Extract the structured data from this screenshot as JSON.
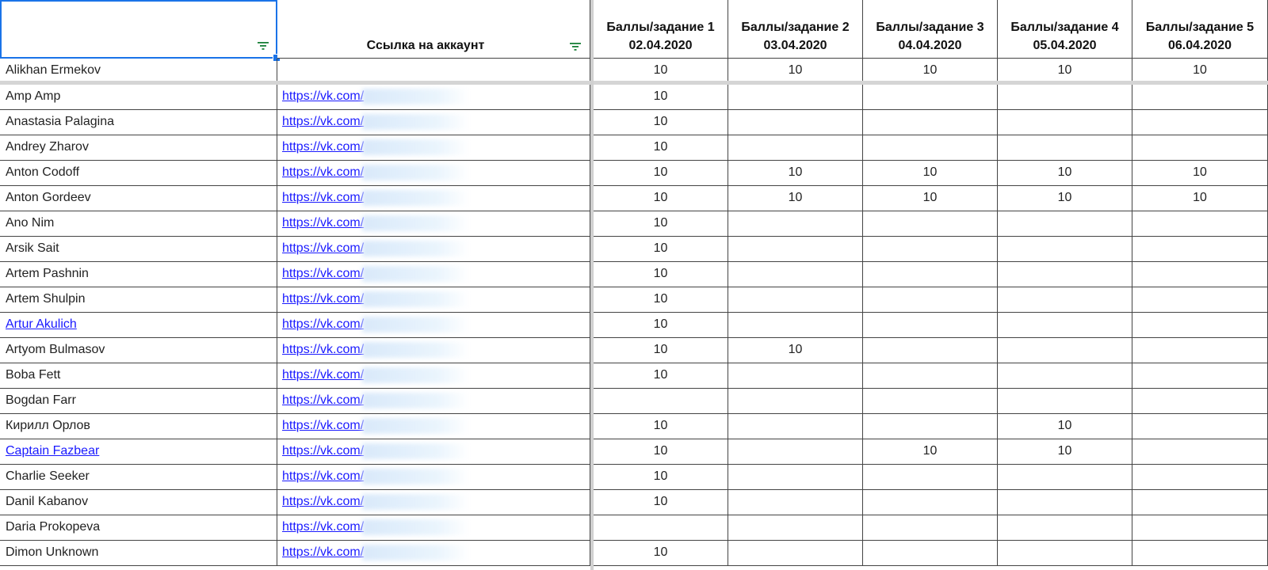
{
  "header": {
    "name_col": "",
    "link_col": "Ссылка на аккаунт",
    "tasks": [
      {
        "label": "Баллы/задание 1",
        "date": "02.04.2020"
      },
      {
        "label": "Баллы/задание 2",
        "date": "03.04.2020"
      },
      {
        "label": "Баллы/задание 3",
        "date": "04.04.2020"
      },
      {
        "label": "Баллы/задание 4",
        "date": "05.04.2020"
      },
      {
        "label": "Баллы/задание 5",
        "date": "06.04.2020"
      }
    ]
  },
  "icons": {
    "filter": "filter-icon"
  },
  "colors": {
    "selection": "#1a73e8",
    "link": "#1a1aff",
    "filter_icon": "#188038"
  },
  "pinned_row": {
    "name": "Alikhan Ermekov",
    "link": "",
    "scores": [
      "10",
      "10",
      "10",
      "10",
      "10"
    ]
  },
  "rows": [
    {
      "name": "Amp Amp",
      "link": "https://vk.com/",
      "scores": [
        "10",
        "",
        "",
        "",
        ""
      ]
    },
    {
      "name": "Anastasia Palagina",
      "link": "https://vk.com/",
      "scores": [
        "10",
        "",
        "",
        "",
        ""
      ]
    },
    {
      "name": "Andrey Zharov",
      "link": "https://vk.com/",
      "scores": [
        "10",
        "",
        "",
        "",
        ""
      ]
    },
    {
      "name": "Anton Codoff",
      "link": "https://vk.com/",
      "scores": [
        "10",
        "10",
        "10",
        "10",
        "10"
      ]
    },
    {
      "name": "Anton Gordeev",
      "link": "https://vk.com/",
      "scores": [
        "10",
        "10",
        "10",
        "10",
        "10"
      ]
    },
    {
      "name": "Ano Nim",
      "link": "https://vk.com/",
      "scores": [
        "10",
        "",
        "",
        "",
        ""
      ]
    },
    {
      "name": "Arsik Sait",
      "link": "https://vk.com/",
      "scores": [
        "10",
        "",
        "",
        "",
        ""
      ]
    },
    {
      "name": "Artem Pashnin",
      "link": "https://vk.com/",
      "scores": [
        "10",
        "",
        "",
        "",
        ""
      ]
    },
    {
      "name": "Artem Shulpin",
      "link": "https://vk.com/",
      "scores": [
        "10",
        "",
        "",
        "",
        ""
      ]
    },
    {
      "name": "Artur Akulich",
      "name_is_link": true,
      "link": "https://vk.com/",
      "scores": [
        "10",
        "",
        "",
        "",
        ""
      ]
    },
    {
      "name": "Artyom Bulmasov",
      "link": "https://vk.com/",
      "scores": [
        "10",
        "10",
        "",
        "",
        ""
      ]
    },
    {
      "name": "Boba Fett",
      "link": "https://vk.com/",
      "scores": [
        "10",
        "",
        "",
        "",
        ""
      ]
    },
    {
      "name": "Bogdan Farr",
      "link": "https://vk.com/",
      "scores": [
        "",
        "",
        "",
        "",
        ""
      ]
    },
    {
      "name": "Кирилл Орлов",
      "link": "https://vk.com/",
      "scores": [
        "10",
        "",
        "",
        "10",
        ""
      ]
    },
    {
      "name": "Captain Fazbear",
      "name_is_link": true,
      "link": "https://vk.com/",
      "scores": [
        "10",
        "",
        "10",
        "10",
        ""
      ]
    },
    {
      "name": "Charlie Seeker",
      "link": "https://vk.com/",
      "scores": [
        "10",
        "",
        "",
        "",
        ""
      ]
    },
    {
      "name": "Danil Kabanov",
      "link": "https://vk.com/",
      "scores": [
        "10",
        "",
        "",
        "",
        ""
      ]
    },
    {
      "name": "Daria Prokopeva",
      "link": "https://vk.com/",
      "scores": [
        "",
        "",
        "",
        "",
        ""
      ]
    },
    {
      "name": "Dimon Unknown",
      "link": "https://vk.com/",
      "scores": [
        "10",
        "",
        "",
        "",
        ""
      ]
    }
  ]
}
